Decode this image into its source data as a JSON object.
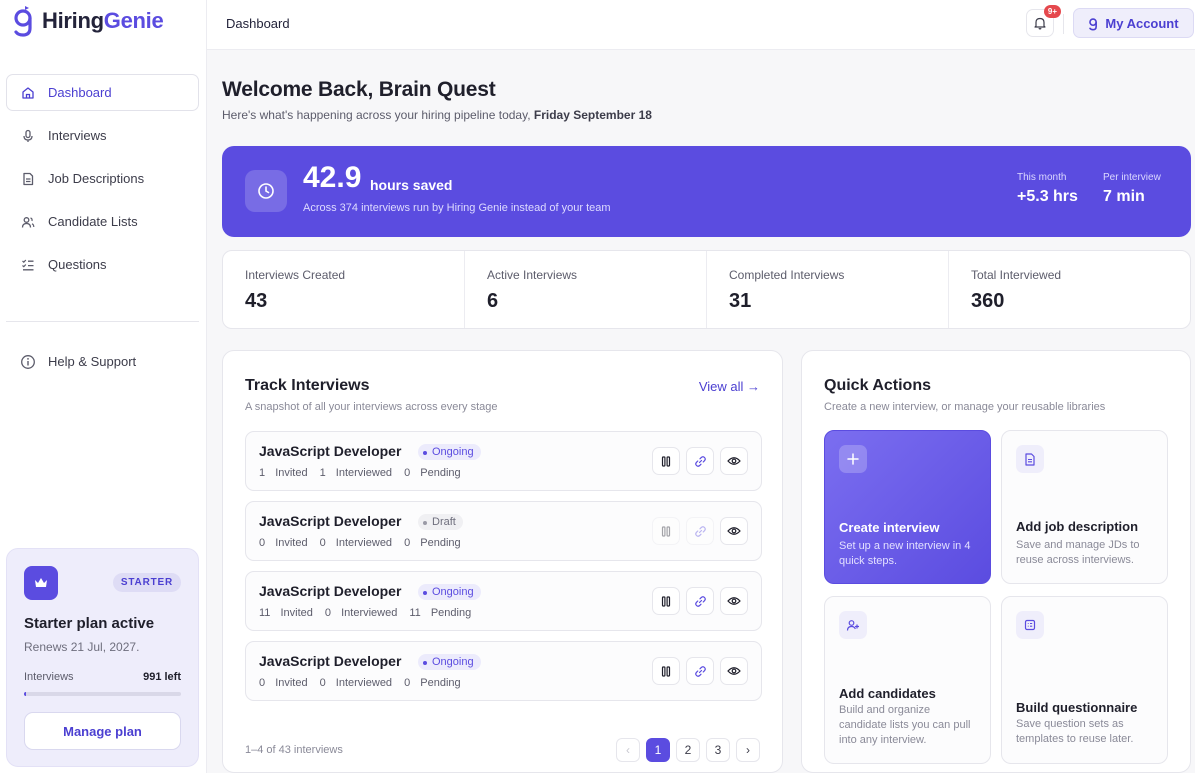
{
  "brand": {
    "name_part1": "Hiring",
    "name_part2": "Genie"
  },
  "sidebar": {
    "items": [
      {
        "label": "Dashboard",
        "icon": "home-icon"
      },
      {
        "label": "Interviews",
        "icon": "microphone-icon"
      },
      {
        "label": "Job Descriptions",
        "icon": "document-icon"
      },
      {
        "label": "Candidate Lists",
        "icon": "users-icon"
      },
      {
        "label": "Questions",
        "icon": "checklist-icon"
      }
    ],
    "help_label": "Help & Support"
  },
  "plan": {
    "badge": "STARTER",
    "title": "Starter plan active",
    "renews": "Renews 21 Jul, 2027.",
    "usage_label": "Interviews",
    "usage_left": "991 left",
    "usage_fraction": 0.01,
    "button": "Manage plan"
  },
  "topbar": {
    "breadcrumb": "Dashboard",
    "notification_badge": "9+",
    "account_label": "My Account"
  },
  "welcome": {
    "title": "Welcome Back, Brain Quest",
    "subtitle_prefix": "Here's what's happening across your hiring pipeline today,",
    "subtitle_date": "Friday September 18"
  },
  "hero": {
    "value": "42.9",
    "unit": "hours saved",
    "description": "Across 374 interviews run by Hiring Genie instead of your team",
    "stats": [
      {
        "label": "This month",
        "value": "+5.3 hrs"
      },
      {
        "label": "Per interview",
        "value": "7 min"
      }
    ]
  },
  "stats": [
    {
      "label": "Interviews Created",
      "value": "43"
    },
    {
      "label": "Active Interviews",
      "value": "6"
    },
    {
      "label": "Completed Interviews",
      "value": "31"
    },
    {
      "label": "Total Interviewed",
      "value": "360"
    }
  ],
  "track": {
    "title": "Track Interviews",
    "subtitle": "A snapshot of all your interviews across every stage",
    "view_all": "View all →",
    "rows": [
      {
        "title": "JavaScript Developer",
        "status": "Ongoing",
        "invited": "1",
        "interviewed": "1",
        "pending": "0"
      },
      {
        "title": "JavaScript Developer",
        "status": "Draft",
        "invited": "0",
        "interviewed": "0",
        "pending": "0"
      },
      {
        "title": "JavaScript Developer",
        "status": "Ongoing",
        "invited": "11",
        "interviewed": "0",
        "pending": "11"
      },
      {
        "title": "JavaScript Developer",
        "status": "Ongoing",
        "invited": "0",
        "interviewed": "0",
        "pending": "0"
      }
    ],
    "labels": {
      "invited": "Invited",
      "interviewed": "Interviewed",
      "pending": "Pending"
    },
    "pager_info": "1–4 of 43 interviews",
    "pages": [
      "1",
      "2",
      "3"
    ],
    "prev": "‹",
    "next": "›"
  },
  "quick_actions": {
    "title": "Quick Actions",
    "subtitle": "Create a new interview, or manage your reusable libraries",
    "tiles": [
      {
        "title": "Create interview",
        "desc": "Set up a new interview in 4 quick steps.",
        "icon": "plus-icon"
      },
      {
        "title": "Add job description",
        "desc": "Save and manage JDs to reuse across interviews.",
        "icon": "document-icon"
      },
      {
        "title": "Add candidates",
        "desc": "Build and organize candidate lists you can pull into any interview.",
        "icon": "user-plus-icon"
      },
      {
        "title": "Build questionnaire",
        "desc": "Save question sets as templates to reuse later.",
        "icon": "list-icon"
      }
    ]
  },
  "colors": {
    "accent": "#5b4ce0",
    "danger": "#e5484d"
  }
}
